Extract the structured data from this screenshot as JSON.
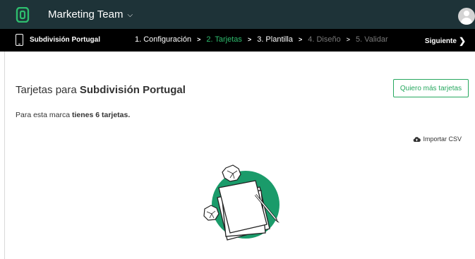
{
  "header": {
    "team_name": "Marketing Team"
  },
  "stepbar": {
    "brand": "Subdivisión Portugal",
    "steps": [
      {
        "label": "1. Configuración",
        "state": "done"
      },
      {
        "label": "2. Tarjetas",
        "state": "active"
      },
      {
        "label": "3. Plantilla",
        "state": "done"
      },
      {
        "label": "4. Diseño",
        "state": "disabled"
      },
      {
        "label": "5. Validar",
        "state": "disabled"
      }
    ],
    "next_label": "Siguiente"
  },
  "main": {
    "title_prefix": "Tarjetas para",
    "title_brand": "Subdivisión Portugal",
    "more_cards_button": "Quiero más tarjetas",
    "subtitle_prefix": "Para esta marca",
    "subtitle_bold": "tienes 6 tarjetas.",
    "import_label": "Importar CSV"
  },
  "colors": {
    "topbar": "#1e3338",
    "stepbar": "#000000",
    "accent_green": "#2ebd6e",
    "illustration_green": "#1a9b6a"
  },
  "icons": [
    "brand-logo-icon",
    "chevron-down-icon",
    "avatar-icon",
    "mobile-device-icon",
    "chevron-right-icon",
    "cloud-upload-icon"
  ]
}
